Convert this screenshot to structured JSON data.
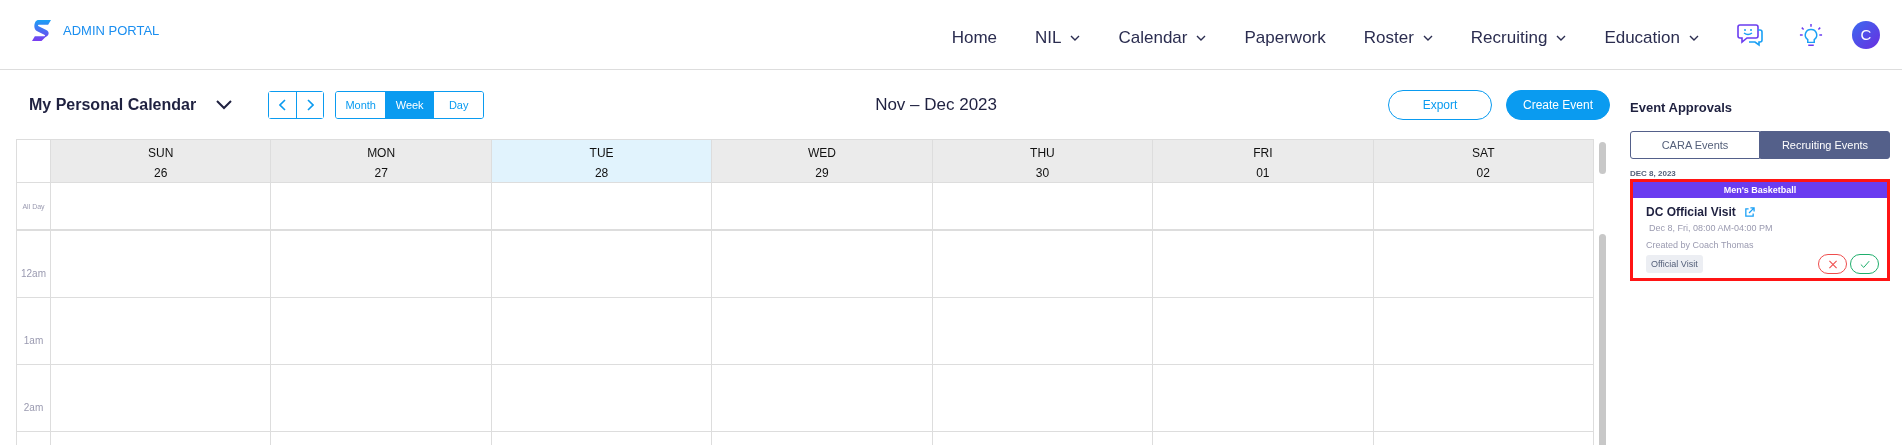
{
  "header": {
    "logo_text": "ADMIN PORTAL",
    "nav": [
      {
        "label": "Home",
        "dropdown": false
      },
      {
        "label": "NIL",
        "dropdown": true
      },
      {
        "label": "Calendar",
        "dropdown": true
      },
      {
        "label": "Paperwork",
        "dropdown": false
      },
      {
        "label": "Roster",
        "dropdown": true
      },
      {
        "label": "Recruiting",
        "dropdown": true
      },
      {
        "label": "Education",
        "dropdown": true
      }
    ],
    "avatar": "C"
  },
  "toolbar": {
    "calendar_select": "My Personal Calendar",
    "views": [
      {
        "label": "Month",
        "selected": false
      },
      {
        "label": "Week",
        "selected": true
      },
      {
        "label": "Day",
        "selected": false
      }
    ],
    "range": "Nov – Dec 2023",
    "buttons": [
      {
        "label": "Export",
        "kind": "outline"
      },
      {
        "label": "Create Event",
        "kind": "primary"
      }
    ]
  },
  "calendar": {
    "days": [
      {
        "name": "SUN",
        "date": "26",
        "today": false
      },
      {
        "name": "MON",
        "date": "27",
        "today": false
      },
      {
        "name": "TUE",
        "date": "28",
        "today": true
      },
      {
        "name": "WED",
        "date": "29",
        "today": false
      },
      {
        "name": "THU",
        "date": "30",
        "today": false
      },
      {
        "name": "FRI",
        "date": "01",
        "today": false
      },
      {
        "name": "SAT",
        "date": "02",
        "today": false
      }
    ],
    "all_day_label": "All Day",
    "hours": [
      "12am",
      "1am",
      "2am"
    ]
  },
  "approvals": {
    "title": "Event Approvals",
    "tabs": [
      {
        "label": "CARA Events",
        "selected": false
      },
      {
        "label": "Recruiting Events",
        "selected": true
      }
    ],
    "groups": [
      {
        "date": "DEC 8, 2023",
        "events": [
          {
            "team": "Men's Basketball",
            "title": "DC Official Visit",
            "time": "Dec 8, Fri,  08:00 AM-04:00 PM",
            "created_by": "Created by Coach Thomas",
            "tag": "Official Visit",
            "highlighted": true
          }
        ]
      }
    ]
  }
}
